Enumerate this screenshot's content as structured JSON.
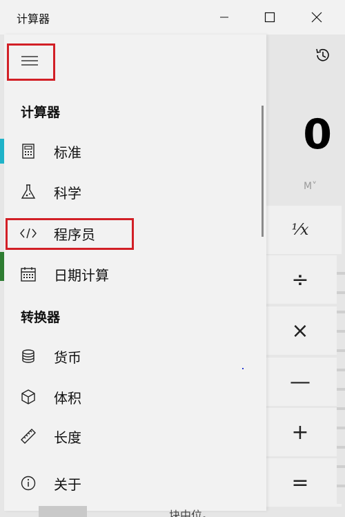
{
  "window": {
    "title": "计算器"
  },
  "calculator": {
    "display": "0",
    "memory_label": "M˅"
  },
  "operators": {
    "reciprocal": "¹⁄x",
    "divide": "÷",
    "multiply": "×",
    "minus": "—",
    "plus": "+",
    "equals": "="
  },
  "nav": {
    "section_calculator": "计算器",
    "section_converter": "转换器",
    "items": [
      {
        "label": "标准",
        "icon": "calculator-icon",
        "selected": true
      },
      {
        "label": "科学",
        "icon": "flask-icon"
      },
      {
        "label": "程序员",
        "icon": "code-icon"
      },
      {
        "label": "日期计算",
        "icon": "calendar-icon"
      },
      {
        "label": "货币",
        "icon": "coins-icon"
      },
      {
        "label": "体积",
        "icon": "cube-icon"
      },
      {
        "label": "长度",
        "icon": "ruler-icon"
      }
    ],
    "about": {
      "label": "关于",
      "icon": "info-icon"
    }
  },
  "colors": {
    "accent": "#1fb3c9",
    "highlight_box": "#d21f26"
  },
  "background_peek": "块中位。"
}
